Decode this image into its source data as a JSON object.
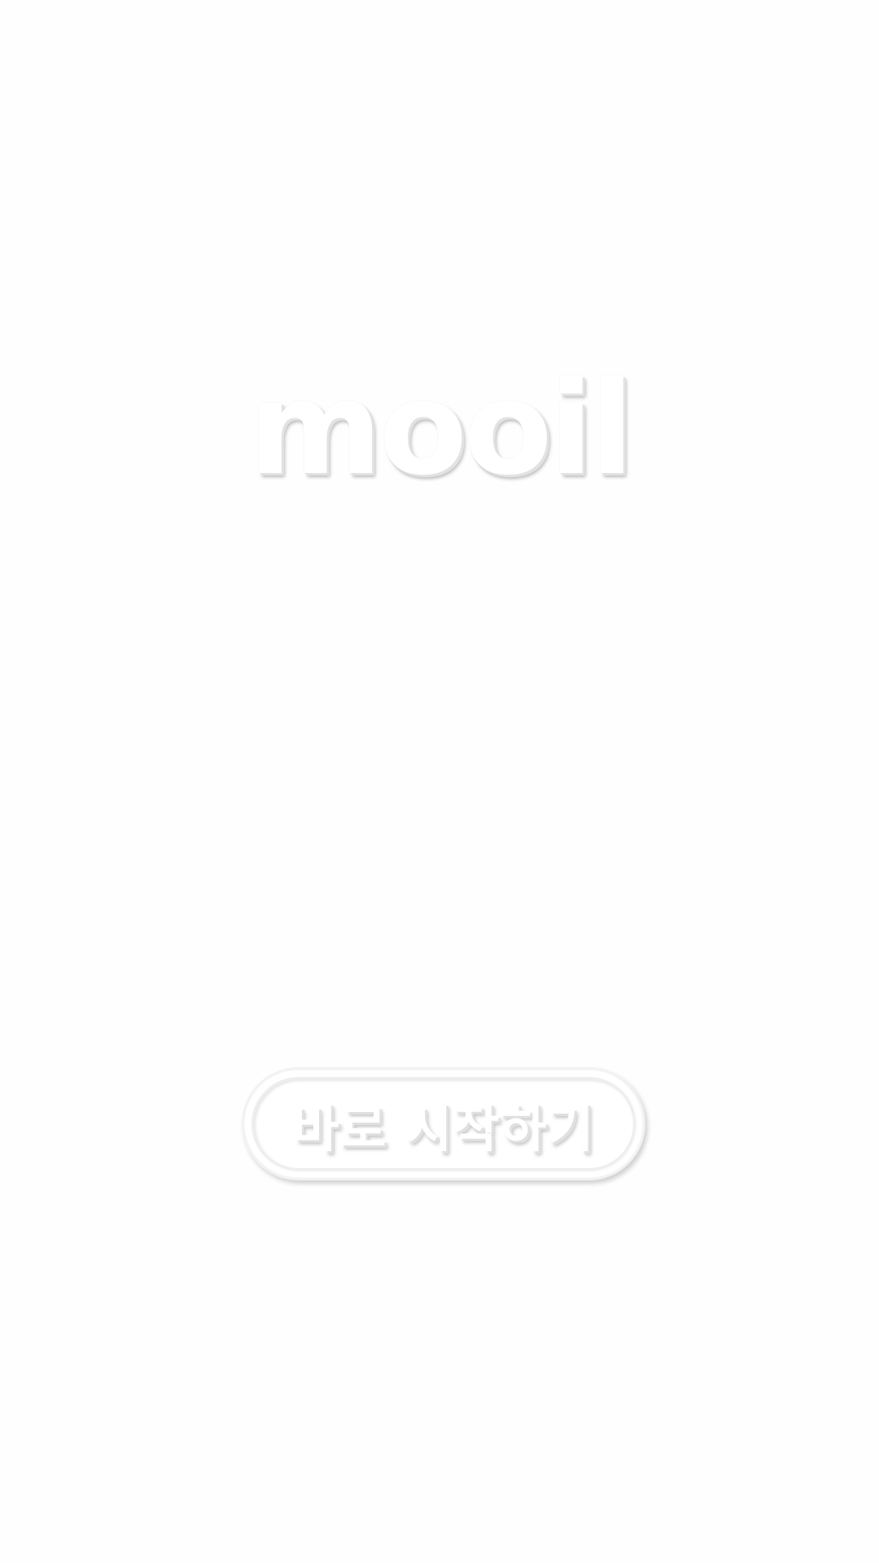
{
  "app": {
    "logo_text": "mooil"
  },
  "actions": {
    "start_label": "바로 시작하기"
  },
  "colors": {
    "background": "#fefefe",
    "text": "#ffffff",
    "shadow": "#e0e0e0"
  }
}
